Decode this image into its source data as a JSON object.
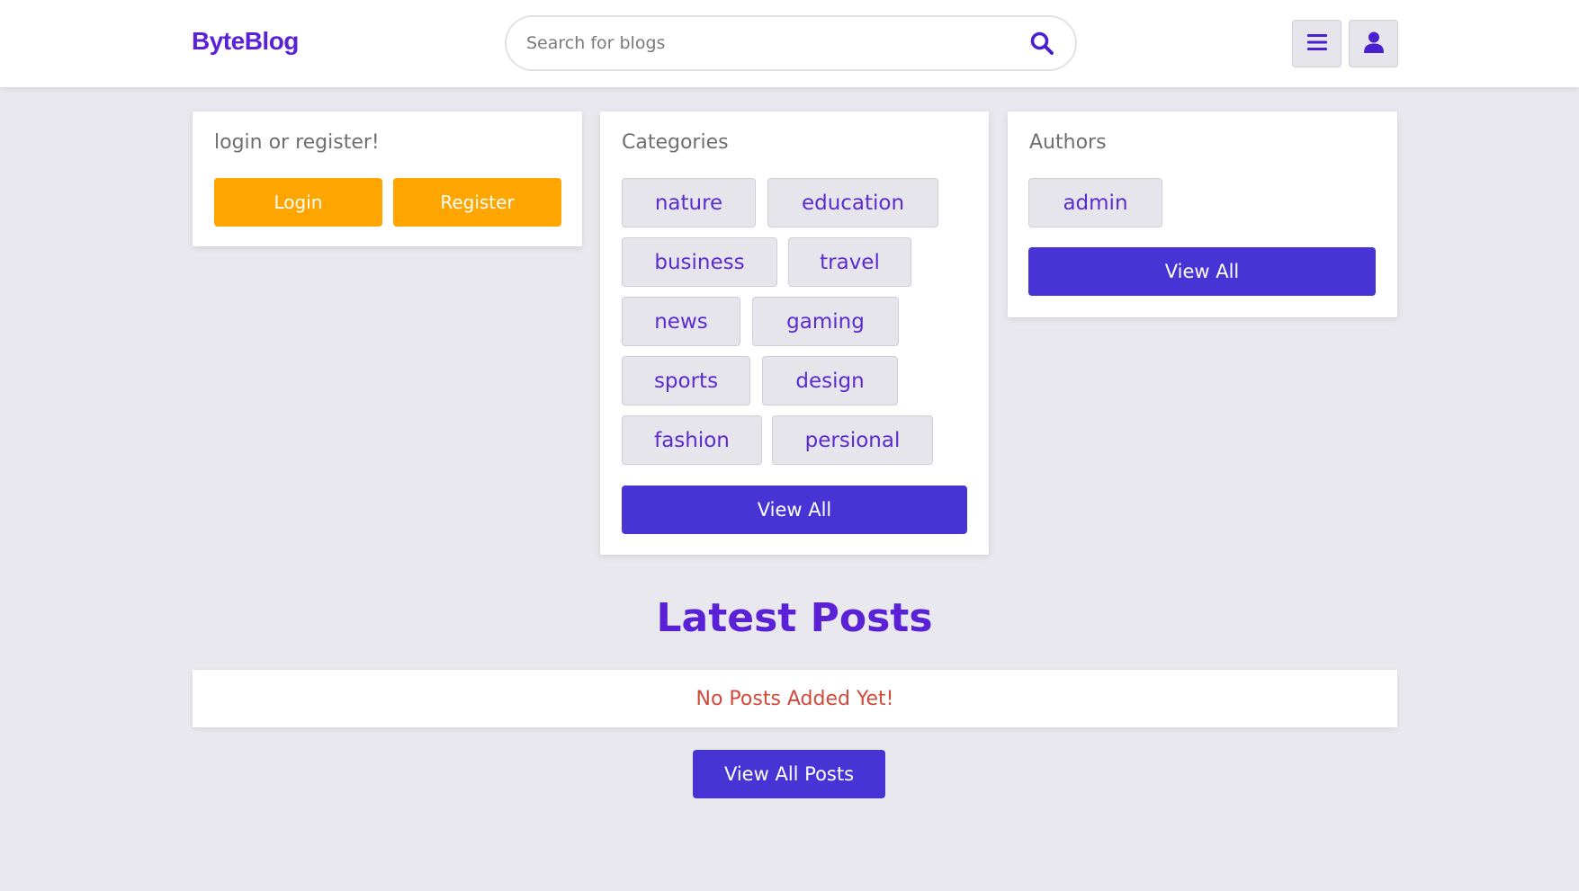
{
  "header": {
    "brand": "ByteBlog",
    "search_placeholder": "Search for blogs",
    "menu_icon": "hamburger-menu-icon",
    "user_icon": "user-icon"
  },
  "login_card": {
    "title": "login or register!",
    "login_label": "Login",
    "register_label": "Register"
  },
  "categories_card": {
    "title": "Categories",
    "items": [
      "nature",
      "education",
      "business",
      "travel",
      "news",
      "gaming",
      "sports",
      "design",
      "fashion",
      "persional"
    ],
    "view_all_label": "View All"
  },
  "authors_card": {
    "title": "Authors",
    "items": [
      "admin"
    ],
    "view_all_label": "View All"
  },
  "latest": {
    "title": "Latest Posts",
    "empty_message": "No Posts Added Yet!",
    "view_all_posts_label": "View All Posts"
  },
  "colors": {
    "brand": "#5b21d6",
    "primary_button": "#4834d4",
    "accent_button": "#ffa500",
    "empty_message": "#d04a3c",
    "background": "#e9e8ee"
  }
}
